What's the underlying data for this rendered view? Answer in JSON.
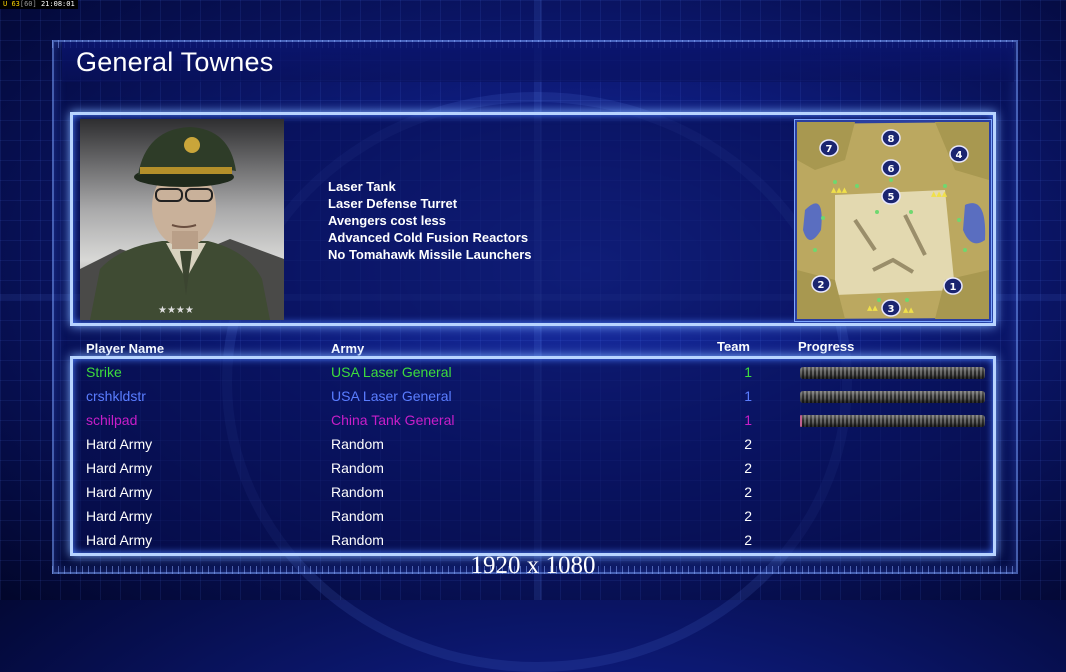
{
  "overlay": {
    "fps_current": "63",
    "fps_target": "60",
    "clock": "21:08:01"
  },
  "general": {
    "name": "General Townes"
  },
  "bonuses": [
    "Laser Tank",
    "Laser Defense Turret",
    "Avengers cost less",
    "Advanced Cold Fusion Reactors",
    "No Tomahawk Missile Launchers"
  ],
  "minimap": {
    "start_positions": [
      "1",
      "2",
      "3",
      "4",
      "5",
      "6",
      "7",
      "8"
    ]
  },
  "columns": {
    "player": "Player Name",
    "army": "Army",
    "team": "Team",
    "progress": "Progress"
  },
  "players": [
    {
      "name": "Strike",
      "army": "USA Laser General",
      "team": "1",
      "color": "#3ddc3d",
      "progress": 0
    },
    {
      "name": "crshkldstr",
      "army": "USA Laser General",
      "team": "1",
      "color": "#5a7dff",
      "progress": 0
    },
    {
      "name": "schilpad",
      "army": "China Tank General",
      "team": "1",
      "color": "#c81ec8",
      "progress": 0.01
    },
    {
      "name": "Hard Army",
      "army": "Random",
      "team": "2",
      "color": "#ffffff"
    },
    {
      "name": "Hard Army",
      "army": "Random",
      "team": "2",
      "color": "#ffffff"
    },
    {
      "name": "Hard Army",
      "army": "Random",
      "team": "2",
      "color": "#ffffff"
    },
    {
      "name": "Hard Army",
      "army": "Random",
      "team": "2",
      "color": "#ffffff"
    },
    {
      "name": "Hard Army",
      "army": "Random",
      "team": "2",
      "color": "#ffffff"
    }
  ],
  "resolution": "1920 x 1080"
}
